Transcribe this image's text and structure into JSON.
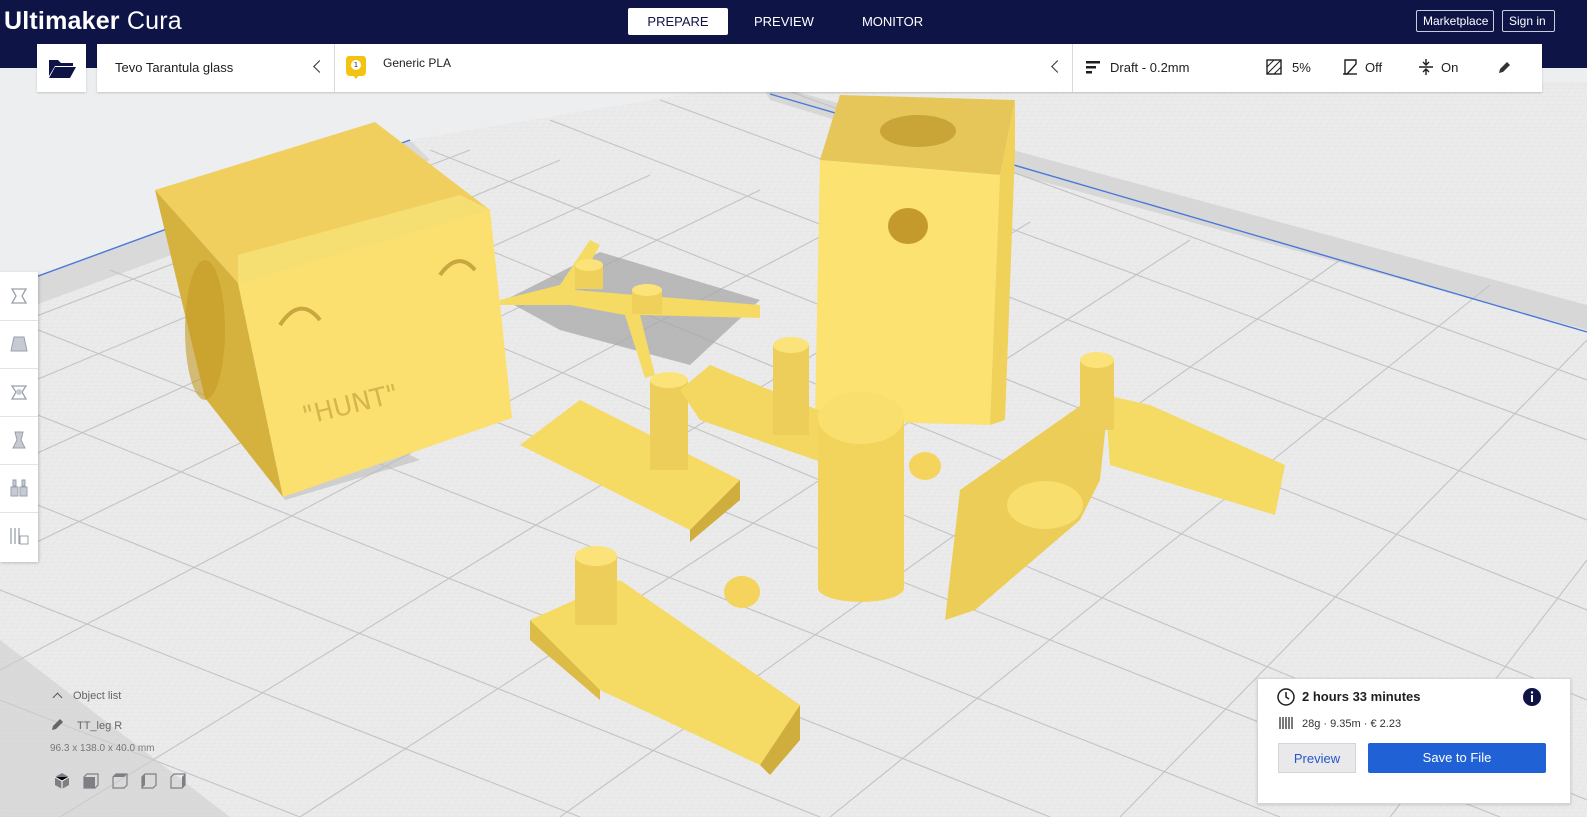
{
  "app": {
    "brand_bold": "Ultimaker",
    "brand_light": "Cura"
  },
  "stages": [
    {
      "label": "PREPARE",
      "active": true
    },
    {
      "label": "PREVIEW",
      "active": false
    },
    {
      "label": "MONITOR",
      "active": false
    }
  ],
  "header_buttons": {
    "marketplace": "Marketplace",
    "sign_in": "Sign in"
  },
  "toolbar": {
    "open_icon": "folder-open-icon",
    "printer": "Tevo Tarantula glass",
    "extruder_number": "1",
    "material": "Generic PLA",
    "profile": "Draft - 0.2mm",
    "infill": "5%",
    "support": "Off",
    "adhesion": "On",
    "edit_icon": "pencil-icon"
  },
  "tools": [
    "move-tool-icon",
    "scale-tool-icon",
    "rotate-tool-icon",
    "mirror-tool-icon",
    "per-model-settings-icon",
    "support-blocker-icon"
  ],
  "object_list": {
    "toggle_label": "Object list",
    "selected_name": "TT_leg R",
    "dimensions": "96.3 x 138.0 x 40.0 mm",
    "view_buttons": [
      "3d-view-icon",
      "front-view-icon",
      "top-view-icon",
      "left-view-icon",
      "right-view-icon"
    ]
  },
  "print_info": {
    "time": "2 hours 33 minutes",
    "usage": "28g · 9.35m · € 2.23",
    "preview_label": "Preview",
    "save_label": "Save to File"
  },
  "colors": {
    "header": "#0f1447",
    "model_yellow": "#f7dc6a",
    "accent_blue": "#2061d6",
    "build_plate": "#e8e8e8"
  }
}
